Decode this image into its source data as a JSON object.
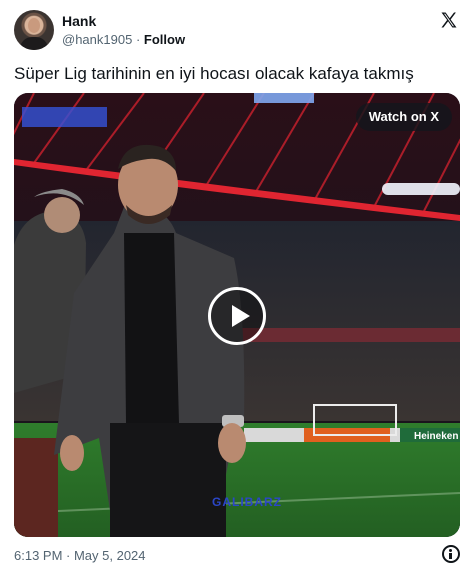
{
  "author": {
    "name": "Hank",
    "handle": "@hank1905",
    "separator": "·",
    "follow_label": "Follow"
  },
  "tweet": {
    "text": "Süper Lig tarihinin en iyi hocası olacak kafaya takmış"
  },
  "media": {
    "watch_label": "Watch on X",
    "watermark": "GALIBARZ",
    "board_text": "Heineken"
  },
  "footer": {
    "timestamp": "6:13 PM · May 5, 2024"
  },
  "colors": {
    "text_primary": "#0f1419",
    "text_secondary": "#536471",
    "stadium_red": "#e02531",
    "pitch_green": "#2e7a2c"
  },
  "icons": {
    "logo": "x-logo-icon",
    "play": "play-icon",
    "info": "info-icon"
  }
}
